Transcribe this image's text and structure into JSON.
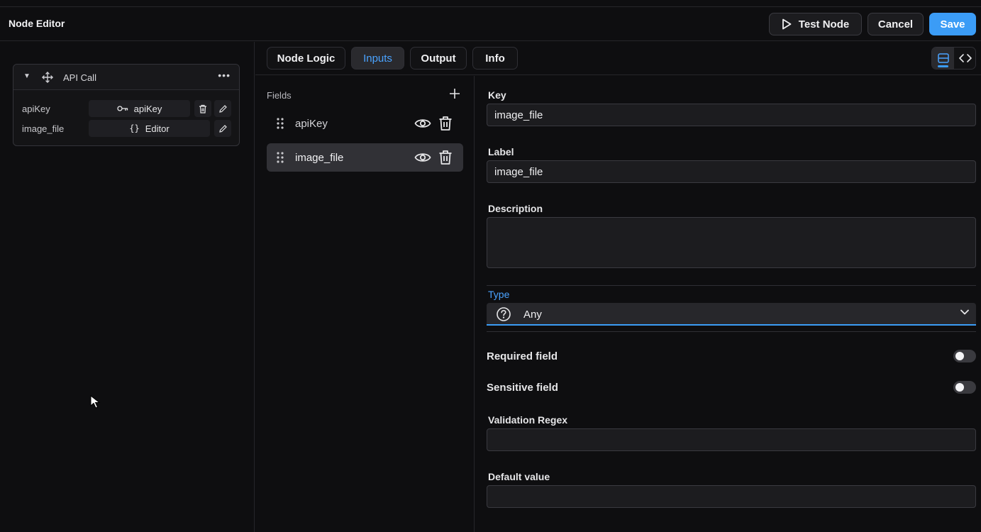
{
  "header": {
    "title": "Node Editor",
    "test_label": "Test Node",
    "cancel_label": "Cancel",
    "save_label": "Save"
  },
  "node_card": {
    "name": "API Call",
    "rows": [
      {
        "label": "apiKey",
        "value": "apiKey"
      },
      {
        "label": "image_file",
        "value": "Editor"
      }
    ]
  },
  "tabs": [
    {
      "label": "Node Logic"
    },
    {
      "label": "Inputs",
      "active": true
    },
    {
      "label": "Output"
    },
    {
      "label": "Info"
    }
  ],
  "fields": {
    "title": "Fields",
    "items": [
      {
        "name": "apiKey"
      },
      {
        "name": "image_file",
        "active": true
      }
    ]
  },
  "props": {
    "key_label": "Key",
    "key_value": "image_file",
    "label_label": "Label",
    "label_value": "image_file",
    "description_label": "Description",
    "description_value": "",
    "type_label": "Type",
    "type_value": "Any",
    "required_label": "Required field",
    "required_on": false,
    "sensitive_label": "Sensitive field",
    "sensitive_on": false,
    "regex_label": "Validation Regex",
    "regex_value": "",
    "default_label": "Default value",
    "default_value": ""
  },
  "colors": {
    "accent": "#3b9cf6",
    "background": "#0e0e10"
  }
}
